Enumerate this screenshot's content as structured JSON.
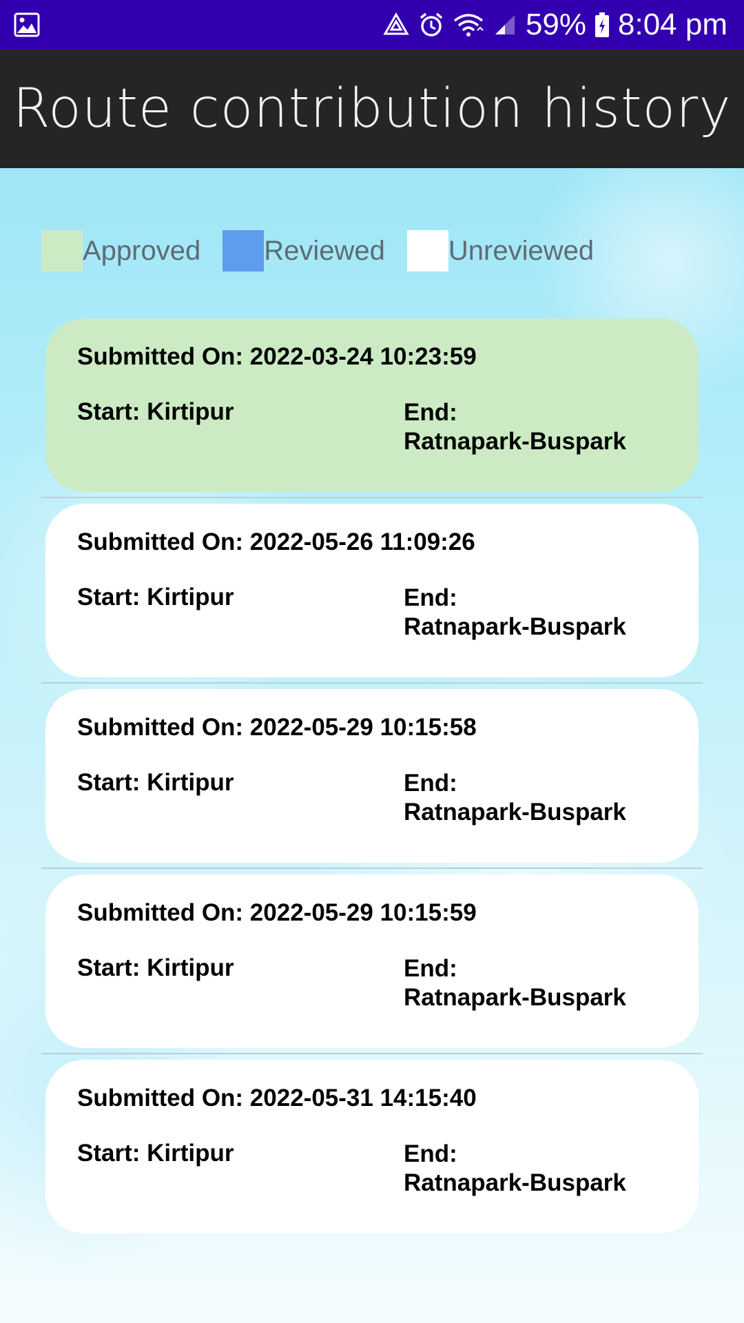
{
  "status_bar": {
    "battery": "59%",
    "time": "8:04 pm",
    "icons": [
      "image-icon",
      "data-saver-icon",
      "alarm-icon",
      "wifi-icon",
      "signal-icon",
      "battery-charging-icon"
    ]
  },
  "app_bar": {
    "title": "Route contribution history"
  },
  "legend": [
    {
      "label": "Approved",
      "color": "#ccebc5"
    },
    {
      "label": "Reviewed",
      "color": "#5e9ced"
    },
    {
      "label": "Unreviewed",
      "color": "#ffffff"
    }
  ],
  "submissions": [
    {
      "submitted": "Submitted On: 2022-03-24 10:23:59",
      "start": "Start: Kirtipur",
      "end_label": "End:",
      "end_value": "Ratnapark-Buspark",
      "status": "Approved",
      "color": "#ccebc5"
    },
    {
      "submitted": "Submitted On: 2022-05-26 11:09:26",
      "start": "Start: Kirtipur",
      "end_label": "End:",
      "end_value": "Ratnapark-Buspark",
      "status": "Unreviewed",
      "color": "#ffffff"
    },
    {
      "submitted": "Submitted On: 2022-05-29 10:15:58",
      "start": "Start: Kirtipur",
      "end_label": "End:",
      "end_value": "Ratnapark-Buspark",
      "status": "Unreviewed",
      "color": "#ffffff"
    },
    {
      "submitted": "Submitted On: 2022-05-29 10:15:59",
      "start": "Start: Kirtipur",
      "end_label": "End:",
      "end_value": "Ratnapark-Buspark",
      "status": "Unreviewed",
      "color": "#ffffff"
    },
    {
      "submitted": "Submitted On: 2022-05-31 14:15:40",
      "start": "Start: Kirtipur",
      "end_label": "End:",
      "end_value": "Ratnapark-Buspark",
      "status": "Unreviewed",
      "color": "#ffffff"
    }
  ]
}
